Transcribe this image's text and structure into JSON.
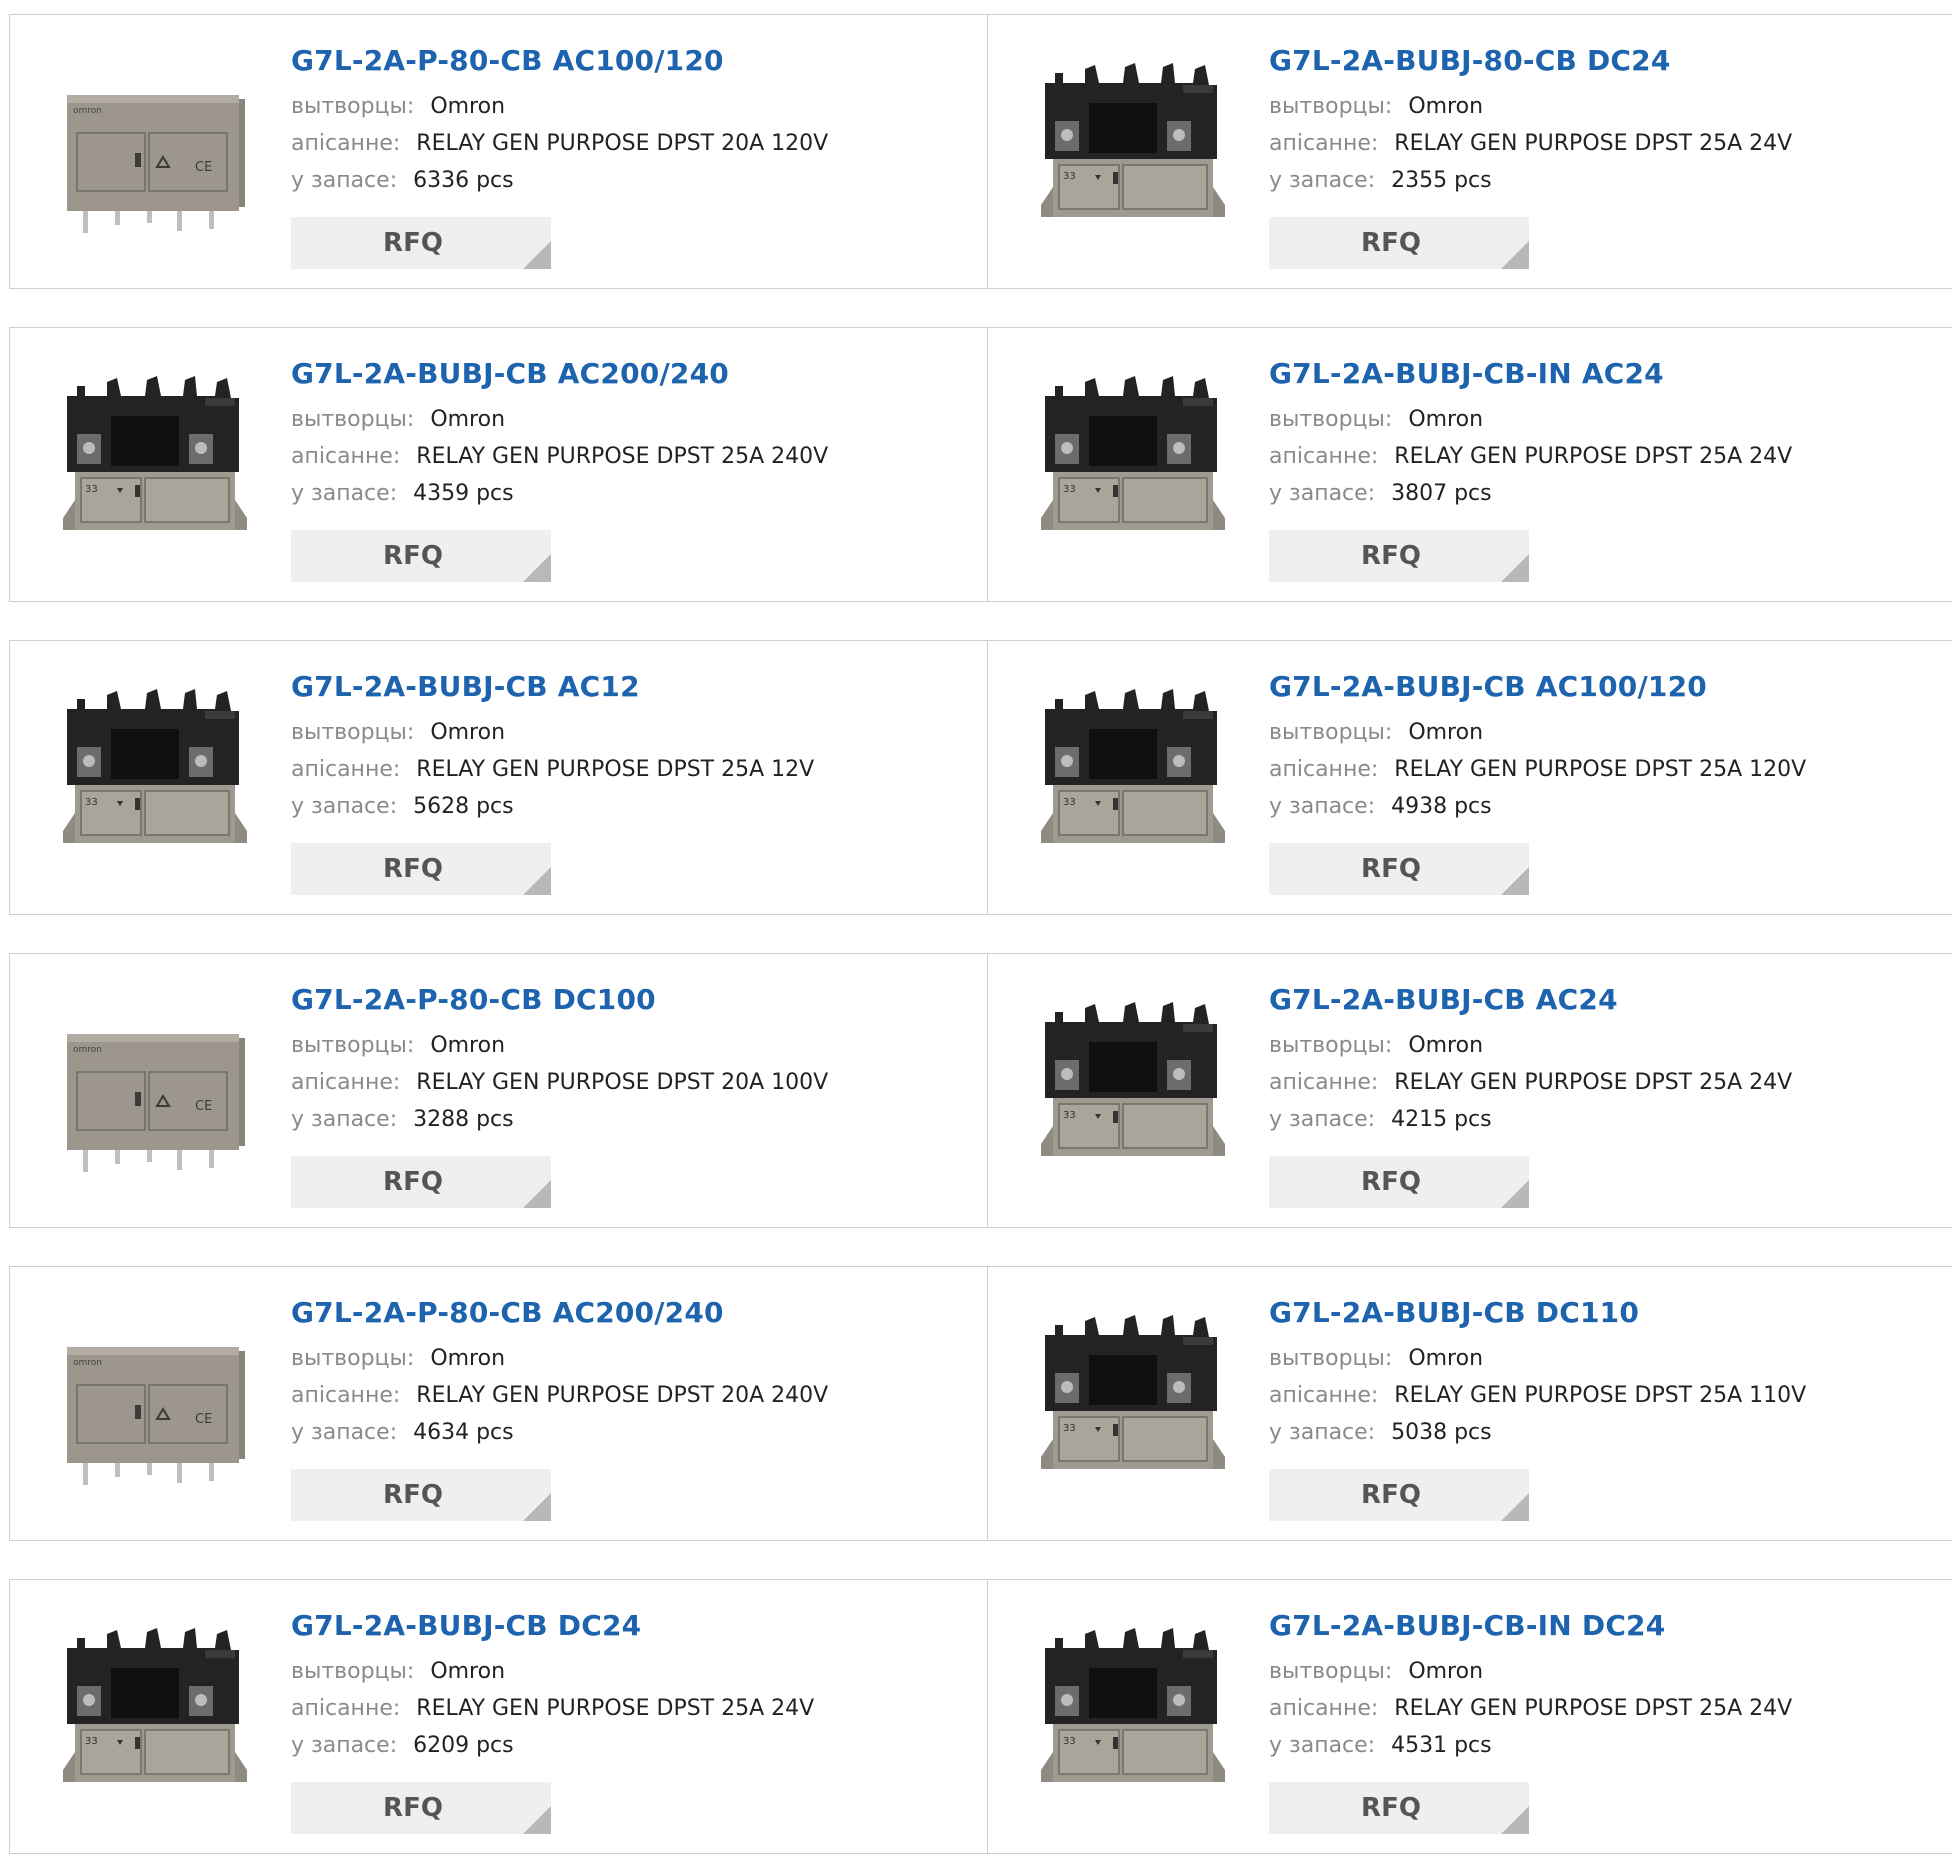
{
  "labels": {
    "manufacturer": "вытворцы:",
    "description": "апісанне:",
    "stock": "у запасе:",
    "rfq": "RFQ"
  },
  "products": [
    {
      "title": "G7L-2A-P-80-CB AC100/120",
      "manufacturer": "Omron",
      "description": "RELAY GEN PURPOSE DPST 20A 120V",
      "stock": "6336 pcs",
      "image": "relay-enclosed-icon"
    },
    {
      "title": "G7L-2A-BUBJ-80-CB DC24",
      "manufacturer": "Omron",
      "description": "RELAY GEN PURPOSE DPST 25A 24V",
      "stock": "2355 pcs",
      "image": "relay-terminal-icon"
    },
    {
      "title": "G7L-2A-BUBJ-CB AC200/240",
      "manufacturer": "Omron",
      "description": "RELAY GEN PURPOSE DPST 25A 240V",
      "stock": "4359 pcs",
      "image": "relay-terminal-icon"
    },
    {
      "title": "G7L-2A-BUBJ-CB-IN AC24",
      "manufacturer": "Omron",
      "description": "RELAY GEN PURPOSE DPST 25A 24V",
      "stock": "3807 pcs",
      "image": "relay-terminal-icon"
    },
    {
      "title": "G7L-2A-BUBJ-CB AC12",
      "manufacturer": "Omron",
      "description": "RELAY GEN PURPOSE DPST 25A 12V",
      "stock": "5628 pcs",
      "image": "relay-terminal-icon"
    },
    {
      "title": "G7L-2A-BUBJ-CB AC100/120",
      "manufacturer": "Omron",
      "description": "RELAY GEN PURPOSE DPST 25A 120V",
      "stock": "4938 pcs",
      "image": "relay-terminal-icon"
    },
    {
      "title": "G7L-2A-P-80-CB DC100",
      "manufacturer": "Omron",
      "description": "RELAY GEN PURPOSE DPST 20A 100V",
      "stock": "3288 pcs",
      "image": "relay-enclosed-icon"
    },
    {
      "title": "G7L-2A-BUBJ-CB AC24",
      "manufacturer": "Omron",
      "description": "RELAY GEN PURPOSE DPST 25A 24V",
      "stock": "4215 pcs",
      "image": "relay-terminal-icon"
    },
    {
      "title": "G7L-2A-P-80-CB AC200/240",
      "manufacturer": "Omron",
      "description": "RELAY GEN PURPOSE DPST 20A 240V",
      "stock": "4634 pcs",
      "image": "relay-enclosed-icon"
    },
    {
      "title": "G7L-2A-BUBJ-CB DC110",
      "manufacturer": "Omron",
      "description": "RELAY GEN PURPOSE DPST 25A 110V",
      "stock": "5038 pcs",
      "image": "relay-terminal-icon"
    },
    {
      "title": "G7L-2A-BUBJ-CB DC24",
      "manufacturer": "Omron",
      "description": "RELAY GEN PURPOSE DPST 25A 24V",
      "stock": "6209 pcs",
      "image": "relay-terminal-icon"
    },
    {
      "title": "G7L-2A-BUBJ-CB-IN DC24",
      "manufacturer": "Omron",
      "description": "RELAY GEN PURPOSE DPST 25A 24V",
      "stock": "4531 pcs",
      "image": "relay-terminal-icon"
    }
  ],
  "colors": {
    "title_link": "#1d63ad",
    "label_gray": "#8a8a8a",
    "border": "#cfcfcf",
    "rfq_bg": "#efefef",
    "rfq_corner": "#b8b8b8"
  }
}
